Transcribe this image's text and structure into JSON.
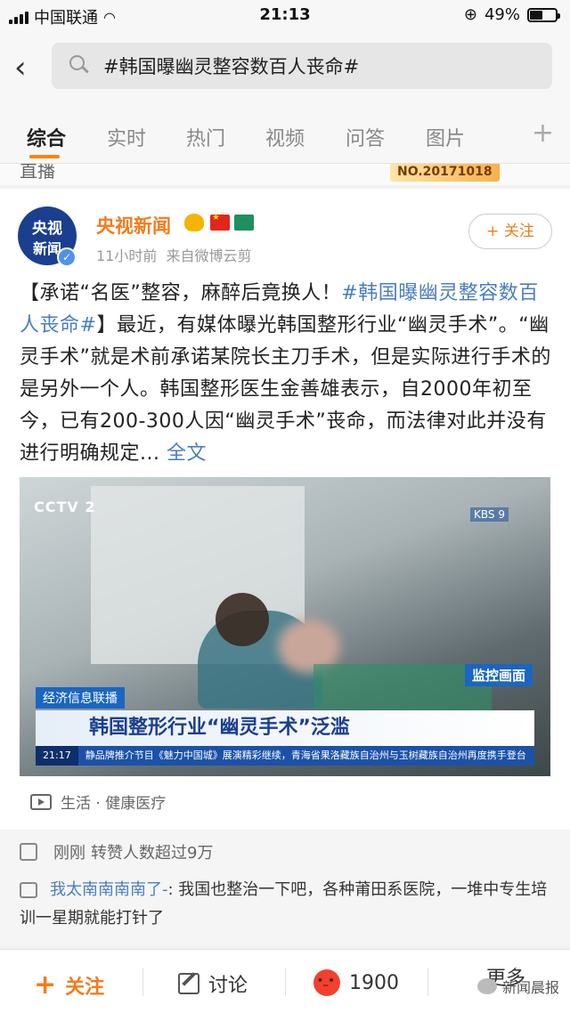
{
  "status_bar": {
    "carrier": "中国联通",
    "time": "21:13",
    "battery": "49%",
    "battery_level": 0.49
  },
  "search": {
    "query": "#韩国曝幽灵整容数百人丧命#"
  },
  "tabs": [
    {
      "label": "综合",
      "active": true
    },
    {
      "label": "实时"
    },
    {
      "label": "热门"
    },
    {
      "label": "视频"
    },
    {
      "label": "问答"
    },
    {
      "label": "图片"
    }
  ],
  "prev_strip": {
    "cut_text": "直播",
    "badge": "NO.20171018"
  },
  "post": {
    "author": "央视新闻",
    "avatar_l1": "央视",
    "avatar_l2": "新闻",
    "time": "11小时前",
    "source": "来自微博云剪",
    "follow_label": "+ 关注",
    "text_prefix": "【承诺“名医”整容，麻醉后竟换人！",
    "text_tag": "#韩国曝幽灵整容数百人丧命#",
    "text_body": "】最近，有媒体曝光韩国整形行业“幽灵手术”。“幽灵手术”就是术前承诺某院长主刀手术，但是实际进行手术的是另外一个人。韩国整形医生金善雄表示，自2000年初至今，已有200-300人因“幽灵手术”丧命，而法律对此并没有进行明确规定...",
    "fulltext_link": "全文",
    "video": {
      "cctv_logo": "CCTV 2",
      "kbs_logo": "KBS 9",
      "monitor_badge": "监控画面",
      "program": "经济信息联播",
      "headline": "韩国整形行业“幽灵手术”泛滥",
      "ticker_time": "21:17",
      "ticker_text": "静品牌推介节目《魅力中国城》展演精彩继续，青海省果洛藏族自治州与玉树藏族自治州再度携手登台"
    },
    "category": "生活 · 健康医疗"
  },
  "interaction": {
    "like_time": "刚刚",
    "like_text": "转赞人数超过9万",
    "comment_user": "我太南南南南了-",
    "comment_text": ": 我国也整治一下吧，各种莆田系医院，一堆中专生培训一星期就能打针了"
  },
  "bottom_bar": {
    "follow": "关注",
    "discuss": "讨论",
    "reactions": "1900",
    "more": "更多"
  },
  "watermark": "新闻晨报",
  "colors": {
    "accent": "#ff8200",
    "author": "#f37b1d",
    "link": "#4a7ec0"
  }
}
